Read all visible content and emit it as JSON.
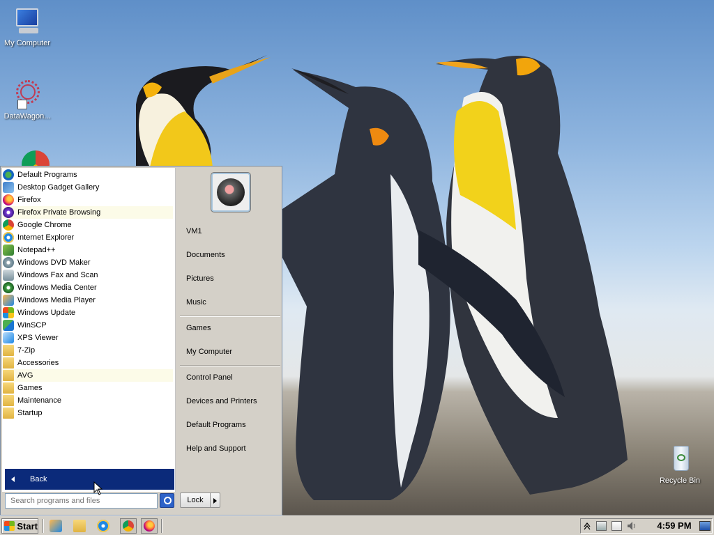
{
  "desktop": {
    "icons": [
      {
        "label": "My Computer"
      },
      {
        "label": "DataWagon..."
      },
      {
        "label": "Recycle Bin"
      }
    ]
  },
  "start_menu": {
    "programs": [
      {
        "label": "Default Programs",
        "icon": "default-programs-icon"
      },
      {
        "label": "Desktop Gadget Gallery",
        "icon": "gadget-gallery-icon"
      },
      {
        "label": "Firefox",
        "icon": "firefox-icon"
      },
      {
        "label": "Firefox Private Browsing",
        "icon": "firefox-private-icon"
      },
      {
        "label": "Google Chrome",
        "icon": "chrome-icon"
      },
      {
        "label": "Internet Explorer",
        "icon": "internet-explorer-icon"
      },
      {
        "label": "Notepad++",
        "icon": "notepad-plus-icon"
      },
      {
        "label": "Windows DVD Maker",
        "icon": "dvd-maker-icon"
      },
      {
        "label": "Windows Fax and Scan",
        "icon": "fax-scan-icon"
      },
      {
        "label": "Windows Media Center",
        "icon": "media-center-icon"
      },
      {
        "label": "Windows Media Player",
        "icon": "media-player-icon"
      },
      {
        "label": "Windows Update",
        "icon": "windows-update-icon"
      },
      {
        "label": "WinSCP",
        "icon": "winscp-icon"
      },
      {
        "label": "XPS Viewer",
        "icon": "xps-viewer-icon"
      },
      {
        "label": "7-Zip",
        "icon": "folder-icon"
      },
      {
        "label": "Accessories",
        "icon": "folder-icon"
      },
      {
        "label": "AVG",
        "icon": "folder-icon"
      },
      {
        "label": "Games",
        "icon": "folder-icon"
      },
      {
        "label": "Maintenance",
        "icon": "folder-icon"
      },
      {
        "label": "Startup",
        "icon": "folder-icon"
      }
    ],
    "back_label": "Back",
    "search_placeholder": "Search programs and files",
    "right": {
      "user": "VM1",
      "group1": [
        "Documents",
        "Pictures",
        "Music"
      ],
      "group2": [
        "Games",
        "My Computer"
      ],
      "group3": [
        "Control Panel",
        "Devices and Printers",
        "Default Programs",
        "Help and Support"
      ]
    },
    "lock_label": "Lock"
  },
  "taskbar": {
    "start_label": "Start",
    "clock": "4:59 PM"
  }
}
